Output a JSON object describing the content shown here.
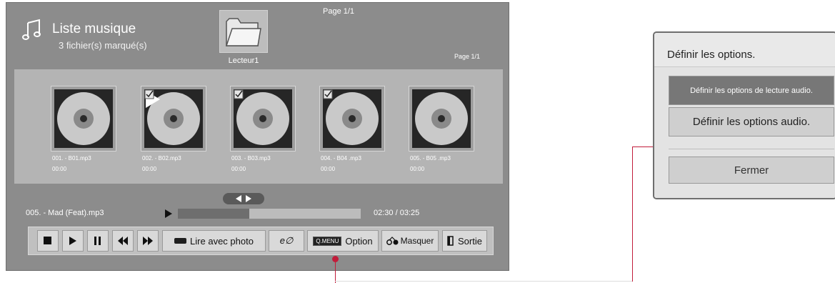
{
  "header": {
    "title": "Liste musique",
    "subtitle": "3 fichier(s) marqué(s)",
    "page_top": "Page 1/1",
    "page_right": "Page 1/1",
    "folder_label": "Lecteur1",
    "icons": [
      "music-note-icon",
      "folder-icon"
    ]
  },
  "tracks": [
    {
      "name": "001. - B01.mp3",
      "time": "00:00",
      "playing": false,
      "checked": false
    },
    {
      "name": "002. - B02.mp3",
      "time": "00:00",
      "playing": true,
      "checked": true
    },
    {
      "name": "003. - B03.mp3",
      "time": "00:00",
      "playing": false,
      "checked": true
    },
    {
      "name": "004. - B04 .mp3",
      "time": "00:00",
      "playing": false,
      "checked": true
    },
    {
      "name": "005. - B05 .mp3",
      "time": "00:00",
      "playing": false,
      "checked": false
    }
  ],
  "player": {
    "now_playing": "005. - Mad (Feat).mp3",
    "time": "02:30 / 03:25",
    "progress": 0.39
  },
  "controls": {
    "buttons": [
      "stop-icon",
      "play-icon",
      "pause-icon",
      "rewind-icon",
      "fast-forward-icon"
    ],
    "photo_label": "Lire avec photo",
    "energy_label": "e∅",
    "qmenu_key": "Q.MENU",
    "option_label": "Option",
    "hide_label": "Masquer",
    "exit_label": "Sortie"
  },
  "dialog": {
    "title": "Définir les options.",
    "option1": "Définir les options de lecture audio.",
    "option2": "Définir les options audio.",
    "close": "Fermer"
  },
  "colors": {
    "screen_bg": "#8c8c8c",
    "thumb_area_bg": "#b4b4b4",
    "callout": "#c11c3a",
    "selected_option_bg": "#777777"
  }
}
